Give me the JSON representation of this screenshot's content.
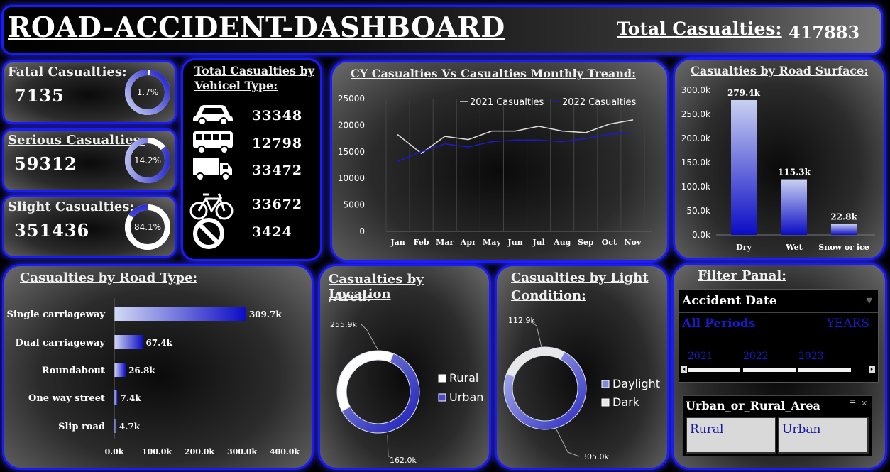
{
  "header": {
    "title": "ROAD-ACCIDENT-DASHBOARD",
    "total_label": "Total Casualties:",
    "total_value": "417883"
  },
  "kpis": [
    {
      "label": "Fatal Casualties:",
      "value": "7135",
      "pct": "1.7%",
      "share": 0.017
    },
    {
      "label": "Serious Casualties:",
      "value": "59312",
      "pct": "14.2%",
      "share": 0.142
    },
    {
      "label": "Slight Casualties:",
      "value": "351436",
      "pct": "84.1%",
      "share": 0.841
    }
  ],
  "vehicle": {
    "title_line1": "Total Casualties by",
    "title_line2": "Vehicel Type:",
    "items": [
      {
        "icon": "car-icon",
        "value": "33348"
      },
      {
        "icon": "bus-icon",
        "value": "12798"
      },
      {
        "icon": "truck-icon",
        "value": "33472"
      },
      {
        "icon": "bicycle-icon",
        "value": "33672"
      },
      {
        "icon": "prohibited-icon",
        "value": "3424"
      }
    ]
  },
  "colors": {
    "accent": "#1a1aff",
    "dark_blue": "#0d0dc8",
    "light_blue": "#c5cdf0",
    "white": "#ffffff"
  },
  "chart_data": [
    {
      "type": "line",
      "title": "CY Casualties Vs Casualties Monthly Treand:",
      "x": [
        "Jan",
        "Feb",
        "Mar",
        "Apr",
        "May",
        "Jun",
        "Jul",
        "Aug",
        "Sep",
        "Oct",
        "Nov"
      ],
      "series": [
        {
          "name": "2021 Casualties",
          "values": [
            18200,
            14700,
            17900,
            17300,
            18900,
            18900,
            19800,
            18900,
            18600,
            20200,
            21000
          ],
          "color": "#dddddd"
        },
        {
          "name": "2022 Casualties",
          "values": [
            13200,
            15000,
            16500,
            15900,
            16900,
            17200,
            17200,
            16900,
            17500,
            18300,
            18500
          ],
          "color": "#1a1acc"
        }
      ],
      "ylim": [
        0,
        25000
      ],
      "yticks": [
        "0",
        "5000",
        "10000",
        "15000",
        "20000",
        "25000"
      ],
      "legend": "top-right",
      "grid": true
    },
    {
      "type": "bar",
      "title": "Casualties by Road Surface:",
      "categories": [
        "Dry",
        "Wet",
        "Snow or ice"
      ],
      "values": [
        279.4,
        115.3,
        22.8
      ],
      "data_labels": [
        "279.4k",
        "115.3k",
        "22.8k"
      ],
      "ylim": [
        0,
        300
      ],
      "yticks": [
        "0.0k",
        "50.0k",
        "100.0k",
        "150.0k",
        "200.0k",
        "250.0k",
        "300.0k"
      ]
    },
    {
      "type": "bar",
      "orientation": "horizontal",
      "title": "Casualties by Road Type:",
      "categories": [
        "Single carriageway",
        "Dual carriageway",
        "Roundabout",
        "One way street",
        "Slip road"
      ],
      "values": [
        309.7,
        67.4,
        26.8,
        7.4,
        4.7
      ],
      "data_labels": [
        "309.7k",
        "67.4k",
        "26.8k",
        "7.4k",
        "4.7k"
      ],
      "xlim": [
        0,
        400
      ],
      "xticks": [
        "0.0k",
        "100.0k",
        "200.0k",
        "300.0k",
        "400.0k"
      ]
    },
    {
      "type": "pie",
      "title_line1": "Casualties by Location",
      "title_line2": "/Area:",
      "labels": [
        "Rural",
        "Urban"
      ],
      "values": [
        162.0,
        255.9
      ],
      "data_labels": [
        "162.0k",
        "255.9k"
      ],
      "colors": [
        "#ffffff",
        "#3333cc"
      ]
    },
    {
      "type": "pie",
      "title_line1": "Casualties by Light",
      "title_line2": "Condition:",
      "labels": [
        "Daylight",
        "Dark"
      ],
      "values": [
        305.0,
        112.9
      ],
      "data_labels": [
        "305.0k",
        "112.9k"
      ],
      "colors": [
        "#7d8ad6",
        "#e6e6e6"
      ]
    }
  ],
  "filter": {
    "title": "Filter Panal:",
    "date_slicer": {
      "title": "Accident Date",
      "selection": "All Periods",
      "unit": "YEARS",
      "years": [
        "2021",
        "2022",
        "2023"
      ]
    },
    "area_slicer": {
      "title": "Urban_or_Rural_Area",
      "options": [
        "Rural",
        "Urban"
      ]
    }
  }
}
